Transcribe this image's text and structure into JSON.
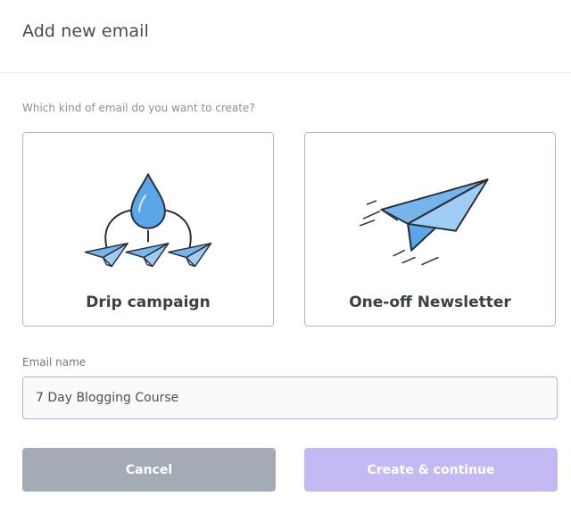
{
  "dialog": {
    "title": "Add new email"
  },
  "email_type": {
    "question": "Which kind of email do you want to create?",
    "options": [
      {
        "label": "Drip campaign",
        "icon": "drip-campaign-icon"
      },
      {
        "label": "One-off Newsletter",
        "icon": "paper-plane-icon"
      }
    ]
  },
  "email_name": {
    "label": "Email name",
    "value": "7 Day Blogging Course"
  },
  "actions": {
    "cancel_label": "Cancel",
    "continue_label": "Create & continue"
  },
  "colors": {
    "card_border": "#b9acf0",
    "drop_blue": "#5aa6e8",
    "plane_blue": "#74b6ec",
    "outline": "#2c2f3a",
    "cancel_button": "#a4abb4",
    "continue_button": "#c4b9f3"
  }
}
